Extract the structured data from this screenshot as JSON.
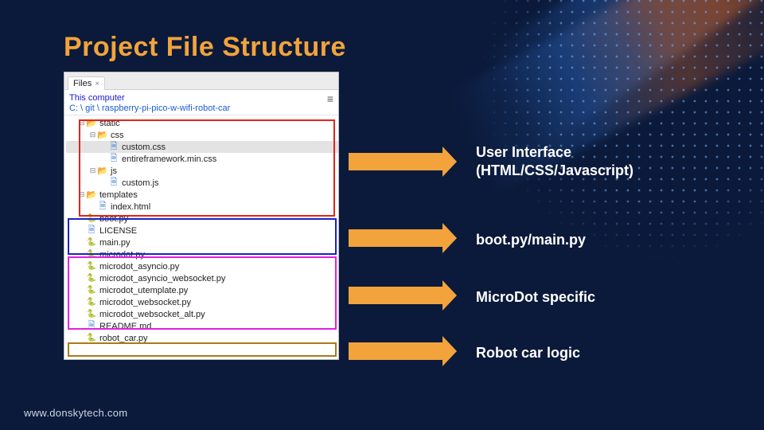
{
  "title": "Project File Structure",
  "footer": "www.donskytech.com",
  "panel": {
    "tab_label": "Files",
    "root_label": "This computer",
    "path": "C: \\ git \\ raspberry-pi-pico-w-wifi-robot-car"
  },
  "tree": {
    "static": "static",
    "css": "css",
    "custom_css": "custom.css",
    "entireframework": "entireframework.min.css",
    "js": "js",
    "custom_js": "custom.js",
    "templates": "templates",
    "index_html": "index.html",
    "boot_py": "boot.py",
    "license": "LICENSE",
    "main_py": "main.py",
    "microdot_py": "microdot.py",
    "microdot_asyncio": "microdot_asyncio.py",
    "microdot_asyncio_ws": "microdot_asyncio_websocket.py",
    "microdot_utemplate": "microdot_utemplate.py",
    "microdot_ws": "microdot_websocket.py",
    "microdot_ws_alt": "microdot_websocket_alt.py",
    "readme": "README.md",
    "robot_car": "robot_car.py"
  },
  "labels": {
    "ui_line1": "User Interface",
    "ui_line2": "(HTML/CSS/Javascript)",
    "boot_main": "boot.py/main.py",
    "microdot": "MicroDot specific",
    "robot": "Robot car logic"
  },
  "colors": {
    "accent": "#f2a33c",
    "bg": "#0b1a3a"
  }
}
